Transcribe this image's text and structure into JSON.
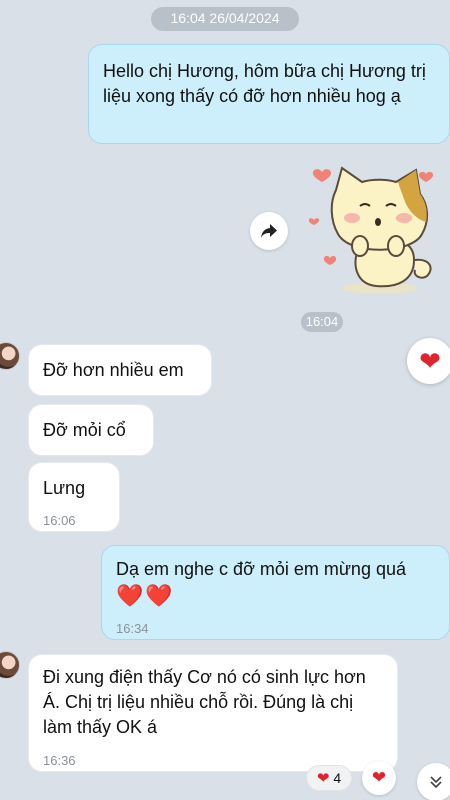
{
  "chat": {
    "date_pill": "16:04 26/04/2024",
    "time_pill": "16:04",
    "messages": [
      {
        "text": "Hello chị Hương, hôm bữa chị Hương trị liệu xong thấy có đỡ hơn nhiều hog ạ"
      },
      {
        "text": "Đỡ hơn nhiều em"
      },
      {
        "text": "Đỡ mỏi cổ"
      },
      {
        "text": "Lưng",
        "time": "16:06"
      },
      {
        "text": "Dạ em nghe c đỡ mỏi em mừng quá",
        "hearts": "❤️❤️",
        "time": "16:34"
      },
      {
        "text": "Đi xung điện thấy Cơ nó có sinh lực hơn Á. Chị trị liệu nhiều chỗ rồi. Đúng là chị làm thấy OK á",
        "time": "16:36"
      }
    ]
  },
  "reactions": {
    "big_heart": "❤",
    "count_heart": "❤",
    "count": "4",
    "react_heart": "❤"
  },
  "icons": {
    "share": "share-arrow-icon",
    "scroll": "chevron-double-down-icon",
    "sticker": "cat-sticker"
  },
  "colors": {
    "background": "#d9e0e8",
    "outgoing_bubble": "#cdeffc",
    "incoming_bubble": "#ffffff",
    "heart": "#e0242d"
  }
}
